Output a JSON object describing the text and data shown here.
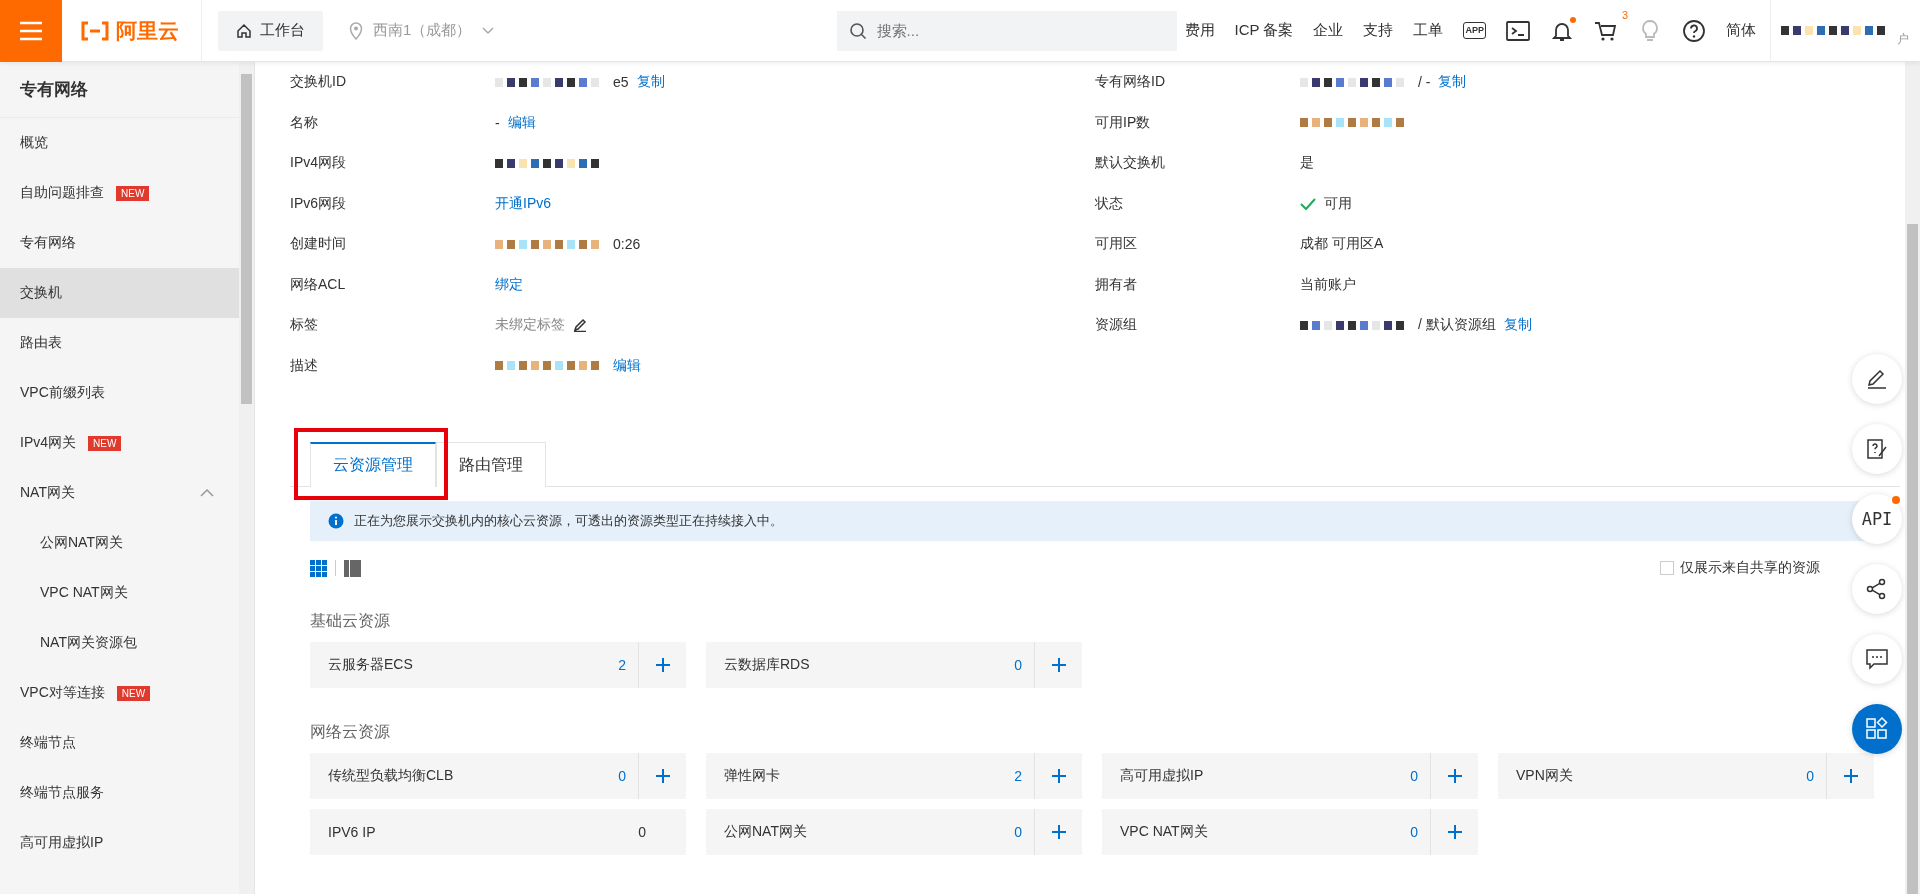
{
  "header": {
    "logo": "阿里云",
    "workbench": "工作台",
    "region": "西南1（成都）",
    "search": {
      "placeholder": "搜索..."
    },
    "nav": [
      {
        "kind": "text",
        "label": "费用"
      },
      {
        "kind": "text",
        "label": "ICP 备案"
      },
      {
        "kind": "text",
        "label": "企业"
      },
      {
        "kind": "text",
        "label": "支持"
      },
      {
        "kind": "text",
        "label": "工单"
      },
      {
        "kind": "app",
        "label": "APP"
      },
      {
        "kind": "terminal"
      },
      {
        "kind": "bell",
        "dot": true
      },
      {
        "kind": "cart",
        "badge": "3"
      },
      {
        "kind": "bulb"
      },
      {
        "kind": "help"
      },
      {
        "kind": "text",
        "label": "简体"
      }
    ],
    "user": {
      "masked": true,
      "fragment": "户"
    }
  },
  "sidebar": {
    "title": "专有网络",
    "items": [
      {
        "label": "概览",
        "selected": false
      },
      {
        "label": "自助问题排查",
        "selected": false,
        "badge": "NEW"
      },
      {
        "label": "专有网络",
        "selected": false
      },
      {
        "label": "交换机",
        "selected": true
      },
      {
        "label": "路由表",
        "selected": false
      },
      {
        "label": "VPC前缀列表",
        "selected": false
      },
      {
        "label": "IPv4网关",
        "selected": false,
        "badge": "NEW"
      },
      {
        "label": "NAT网关",
        "selected": false,
        "expanded": true,
        "children": [
          {
            "label": "公网NAT网关",
            "selected": false
          },
          {
            "label": "VPC NAT网关",
            "selected": false
          },
          {
            "label": "NAT网关资源包",
            "selected": false
          }
        ]
      },
      {
        "label": "VPC对等连接",
        "selected": false,
        "badge": "NEW"
      },
      {
        "label": "终端节点",
        "selected": false
      },
      {
        "label": "终端节点服务",
        "selected": false
      },
      {
        "label": "高可用虚拟IP",
        "selected": false
      }
    ]
  },
  "details": {
    "left": [
      {
        "label": "交换机ID",
        "parts": [
          {
            "kind": "masked"
          },
          {
            "kind": "text",
            "text": "e5"
          },
          {
            "kind": "link",
            "text": "复制"
          }
        ]
      },
      {
        "label": "名称",
        "parts": [
          {
            "kind": "text",
            "text": "-"
          },
          {
            "kind": "link",
            "text": "编辑"
          }
        ]
      },
      {
        "label": "IPv4网段",
        "parts": [
          {
            "kind": "masked"
          }
        ]
      },
      {
        "label": "IPv6网段",
        "parts": [
          {
            "kind": "link",
            "text": "开通IPv6"
          }
        ]
      },
      {
        "label": "创建时间",
        "parts": [
          {
            "kind": "masked"
          },
          {
            "kind": "text",
            "text": "0:26"
          }
        ]
      },
      {
        "label": "网络ACL",
        "parts": [
          {
            "kind": "link",
            "text": "绑定"
          }
        ]
      },
      {
        "label": "标签",
        "parts": [
          {
            "kind": "muted",
            "text": "未绑定标签"
          },
          {
            "kind": "edit"
          }
        ]
      },
      {
        "label": "描述",
        "parts": [
          {
            "kind": "masked"
          },
          {
            "kind": "link",
            "text": "编辑"
          }
        ]
      }
    ],
    "right": [
      {
        "label": "专有网络ID",
        "parts": [
          {
            "kind": "masked"
          },
          {
            "kind": "text",
            "text": "/ -"
          },
          {
            "kind": "link",
            "text": "复制"
          }
        ]
      },
      {
        "label": "可用IP数",
        "parts": [
          {
            "kind": "masked"
          }
        ]
      },
      {
        "label": "默认交换机",
        "parts": [
          {
            "kind": "text",
            "text": "是"
          }
        ]
      },
      {
        "label": "状态",
        "parts": [
          {
            "kind": "status",
            "text": "可用"
          }
        ]
      },
      {
        "label": "可用区",
        "parts": [
          {
            "kind": "text",
            "text": "成都 可用区A"
          }
        ]
      },
      {
        "label": "拥有者",
        "parts": [
          {
            "kind": "text",
            "text": "当前账户"
          }
        ]
      },
      {
        "label": "资源组",
        "parts": [
          {
            "kind": "masked"
          },
          {
            "kind": "text",
            "text": "/ 默认资源组"
          },
          {
            "kind": "link",
            "text": "复制"
          }
        ]
      }
    ]
  },
  "tabs": [
    {
      "label": "云资源管理",
      "selected": true,
      "highlighted": true
    },
    {
      "label": "路由管理",
      "selected": false,
      "highlighted": false
    }
  ],
  "notice": "正在为您展示交换机内的核心云资源，可透出的资源类型正在持续接入中。",
  "view_modes": [
    {
      "kind": "grid",
      "selected": true
    },
    {
      "kind": "list",
      "selected": false
    }
  ],
  "shared_only": {
    "label": "仅展示来自共享的资源",
    "checked": false
  },
  "groups": [
    {
      "title": "基础云资源",
      "items": [
        {
          "name": "云服务器ECS",
          "count": "2",
          "addable": true
        },
        {
          "name": "云数据库RDS",
          "count": "0",
          "addable": true
        }
      ]
    },
    {
      "title": "网络云资源",
      "items": [
        {
          "name": "传统型负载均衡CLB",
          "count": "0",
          "addable": true
        },
        {
          "name": "弹性网卡",
          "count": "2",
          "addable": true
        },
        {
          "name": "高可用虚拟IP",
          "count": "0",
          "addable": true
        },
        {
          "name": "VPN网关",
          "count": "0",
          "addable": true
        },
        {
          "name": "IPV6 IP",
          "count": "0",
          "addable": false
        },
        {
          "name": "公网NAT网关",
          "count": "0",
          "addable": true
        },
        {
          "name": "VPC NAT网关",
          "count": "0",
          "addable": true
        }
      ]
    }
  ],
  "float_tools": [
    {
      "kind": "edit"
    },
    {
      "kind": "clipboard"
    },
    {
      "kind": "api",
      "label": "API",
      "dot": true
    },
    {
      "kind": "share"
    },
    {
      "kind": "chat"
    },
    {
      "kind": "apps",
      "primary": true
    }
  ]
}
